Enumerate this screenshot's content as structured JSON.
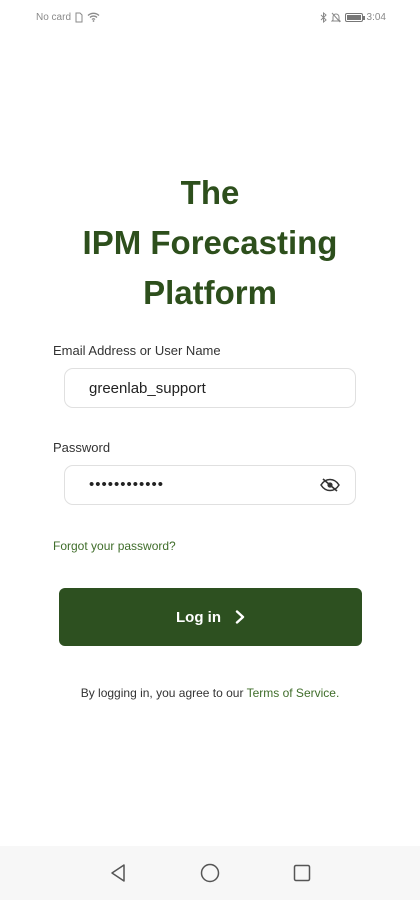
{
  "status_bar": {
    "carrier": "No card",
    "time": "3:04"
  },
  "app": {
    "title_lines": [
      "The",
      "IPM Forecasting",
      "Platform"
    ],
    "accent_color": "#2d5020"
  },
  "form": {
    "email_label": "Email Address or User Name",
    "email_value": "greenlab_support",
    "password_label": "Password",
    "password_masked": "••••••••••••",
    "forgot_link": "Forgot your password?",
    "login_button": "Log in"
  },
  "footer": {
    "terms_prefix": "By logging in, you agree to our ",
    "terms_link": "Terms of Service",
    "terms_suffix": "."
  },
  "icons": {
    "wifi": "wifi-icon",
    "sim": "sim-icon",
    "bluetooth": "bluetooth-icon",
    "mute": "mute-icon",
    "battery": "battery-icon",
    "eye": "eye-off-icon",
    "chevron": "chevron-right-icon",
    "back": "back-icon",
    "home": "home-icon",
    "recents": "recents-icon"
  }
}
